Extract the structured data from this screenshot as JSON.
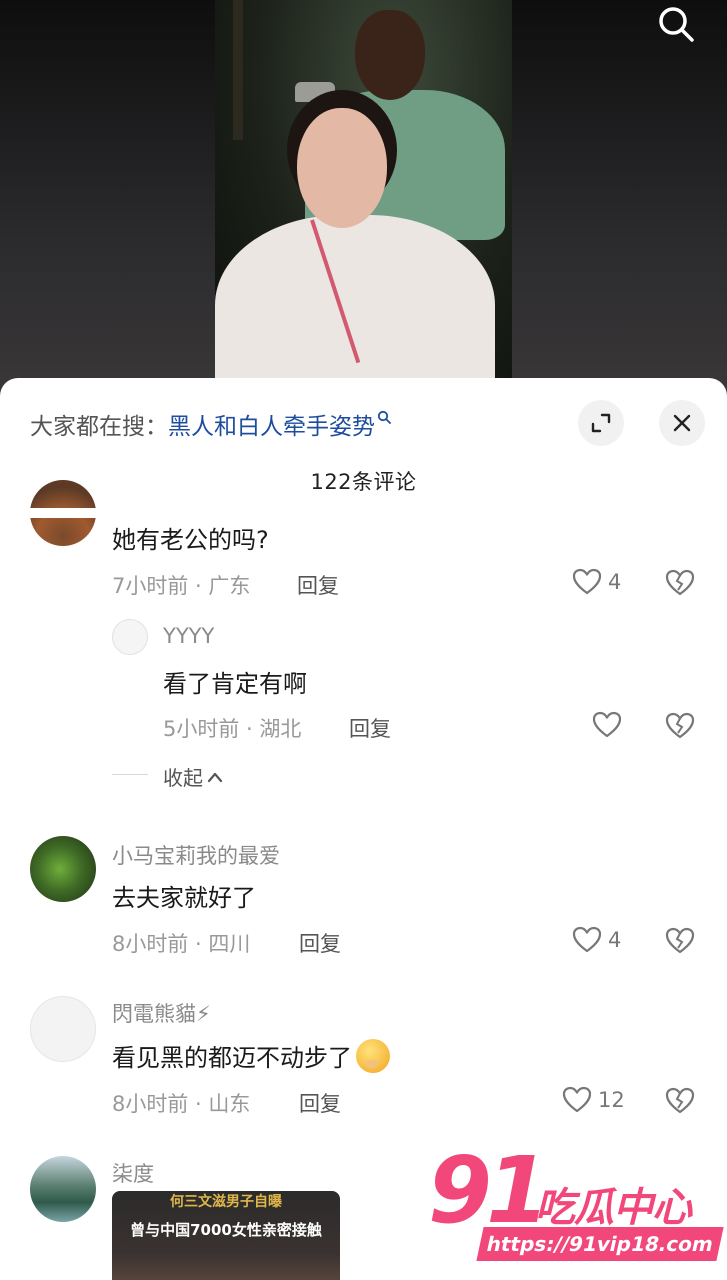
{
  "header": {
    "search_hint_prefix": "大家都在搜：",
    "search_hint_term": "黑人和白人牵手姿势",
    "comment_count": "122条评论"
  },
  "comments": [
    {
      "username": "",
      "content": "她有老公的吗?",
      "meta": "7小时前 · 广东",
      "reply_label": "回复",
      "likes": "4"
    },
    {
      "username": "YYYY",
      "content": "看了肯定有啊",
      "meta": "5小时前 · 湖北",
      "reply_label": "回复",
      "likes": ""
    },
    {
      "username": "小马宝莉我的最爱",
      "content": "去夫家就好了",
      "meta": "8小时前 · 四川",
      "reply_label": "回复",
      "likes": "4"
    },
    {
      "username": "閃電熊貓⚡",
      "content": "看见黑的都迈不动步了",
      "meta": "8小时前 · 山东",
      "reply_label": "回复",
      "likes": "12"
    },
    {
      "username": "柒度",
      "news_line1": "何三文滋男子自曝",
      "news_line2": "曾与中国7000女性亲密接触"
    }
  ],
  "collapse_label": "收起",
  "watermark": {
    "number": "91",
    "text": "吃瓜中心",
    "url": "https://91vip18.com"
  },
  "icons": {
    "search": "search-icon",
    "expand": "expand-icon",
    "close": "close-icon",
    "like": "heart-icon",
    "dislike": "broken-heart-icon",
    "collapse": "chevron-up-icon"
  },
  "colors": {
    "link": "#1d4e9e",
    "watermark": "#f2477a"
  }
}
